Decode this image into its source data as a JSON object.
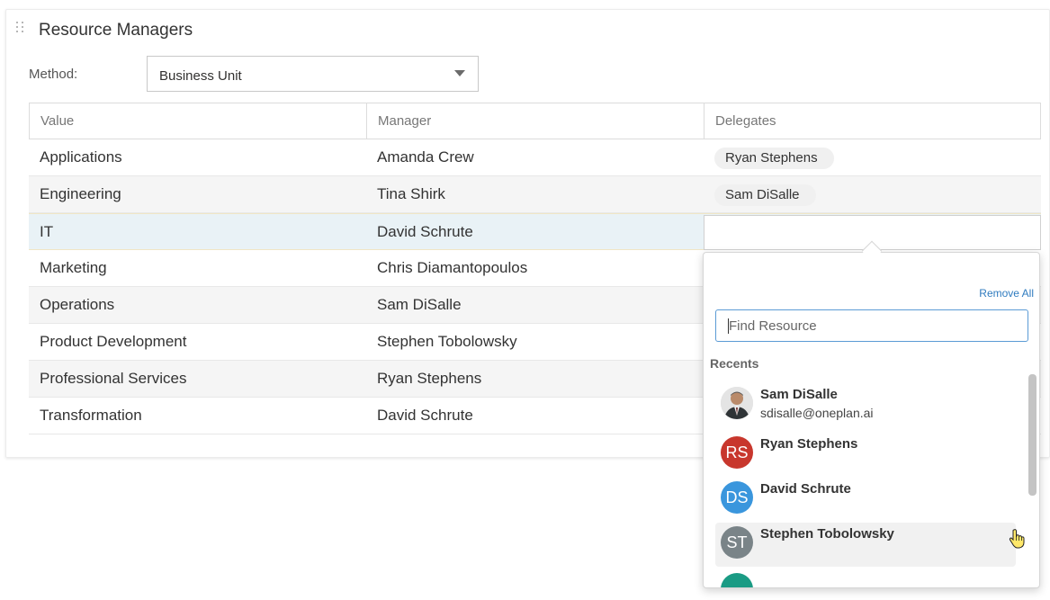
{
  "card": {
    "title": "Resource Managers"
  },
  "method": {
    "label": "Method:",
    "value": "Business Unit"
  },
  "table": {
    "headers": [
      "Value",
      "Manager",
      "Delegates"
    ],
    "rows": [
      {
        "value": "Applications",
        "manager": "Amanda Crew",
        "delegate": "Ryan Stephens"
      },
      {
        "value": "Engineering",
        "manager": "Tina Shirk",
        "delegate": "Sam DiSalle"
      },
      {
        "value": "IT",
        "manager": "David Schrute",
        "delegate": ""
      },
      {
        "value": "Marketing",
        "manager": "Chris Diamantopoulos",
        "delegate": ""
      },
      {
        "value": "Operations",
        "manager": "Sam DiSalle",
        "delegate": ""
      },
      {
        "value": "Product Development",
        "manager": "Stephen Tobolowsky",
        "delegate": ""
      },
      {
        "value": "Professional Services",
        "manager": "Ryan Stephens",
        "delegate": ""
      },
      {
        "value": "Transformation",
        "manager": "David Schrute",
        "delegate": ""
      }
    ]
  },
  "picker": {
    "remove_all": "Remove All",
    "search_placeholder": "Find Resource",
    "recents_label": "Recents",
    "recents": [
      {
        "name": "Sam DiSalle",
        "email": "sdisalle@oneplan.ai",
        "initials": "",
        "color": "#d9d9d9"
      },
      {
        "name": "Ryan Stephens",
        "email": "",
        "initials": "RS",
        "color": "#c8372d"
      },
      {
        "name": "David Schrute",
        "email": "",
        "initials": "DS",
        "color": "#3a96dd"
      },
      {
        "name": "Stephen Tobolowsky",
        "email": "",
        "initials": "ST",
        "color": "#7a8488"
      }
    ]
  },
  "colors": {
    "accent": "#2f7bbf",
    "focus_border": "#5b9bd5",
    "selected_row": "#e9f2f6"
  }
}
